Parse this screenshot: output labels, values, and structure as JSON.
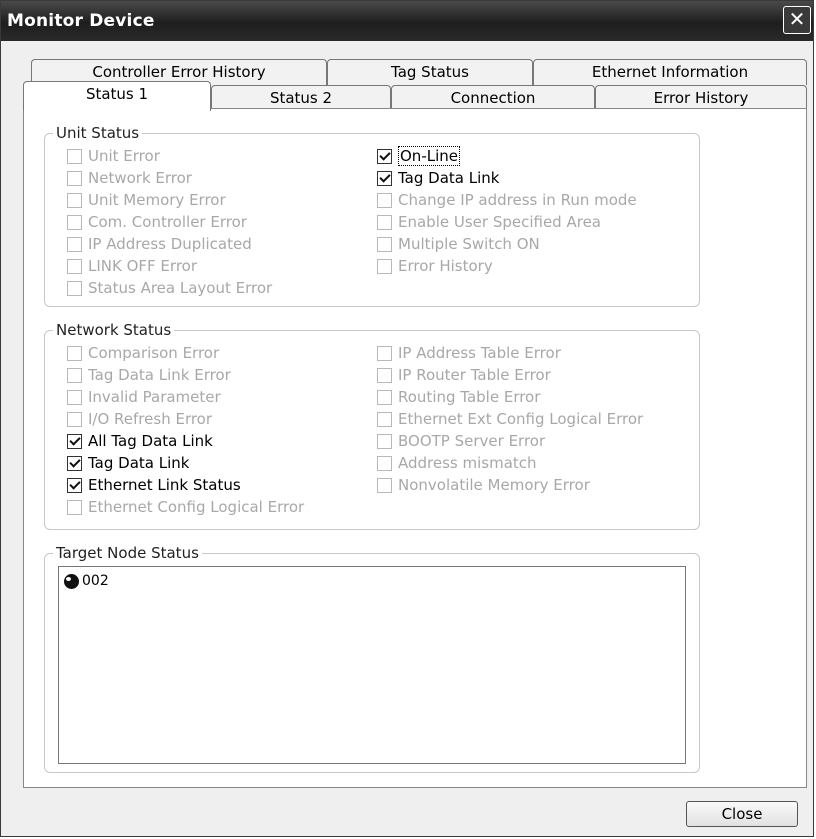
{
  "window": {
    "title": "Monitor Device",
    "close_icon": "close-icon"
  },
  "tabs_back": [
    "Controller Error History",
    "Tag Status",
    "Ethernet Information"
  ],
  "tabs_front": [
    "Status 1",
    "Status 2",
    "Connection",
    "Error History"
  ],
  "active_tab": "Status 1",
  "unit_status": {
    "legend": "Unit Status",
    "left": [
      {
        "label": "Unit Error",
        "checked": false,
        "enabled": false
      },
      {
        "label": "Network Error",
        "checked": false,
        "enabled": false
      },
      {
        "label": "Unit Memory Error",
        "checked": false,
        "enabled": false
      },
      {
        "label": "Com. Controller Error",
        "checked": false,
        "enabled": false
      },
      {
        "label": "IP Address Duplicated",
        "checked": false,
        "enabled": false
      },
      {
        "label": "LINK OFF Error",
        "checked": false,
        "enabled": false
      },
      {
        "label": "Status Area Layout Error",
        "checked": false,
        "enabled": false
      }
    ],
    "right": [
      {
        "label": "On-Line",
        "checked": true,
        "enabled": true
      },
      {
        "label": "Tag Data Link",
        "checked": true,
        "enabled": true
      },
      {
        "label": "Change IP address in Run mode",
        "checked": false,
        "enabled": false
      },
      {
        "label": "Enable User Specified Area",
        "checked": false,
        "enabled": false
      },
      {
        "label": "Multiple Switch ON",
        "checked": false,
        "enabled": false
      },
      {
        "label": "Error History",
        "checked": false,
        "enabled": false
      }
    ]
  },
  "network_status": {
    "legend": "Network Status",
    "left": [
      {
        "label": "Comparison Error",
        "checked": false,
        "enabled": false
      },
      {
        "label": "Tag Data Link Error",
        "checked": false,
        "enabled": false
      },
      {
        "label": "Invalid Parameter",
        "checked": false,
        "enabled": false
      },
      {
        "label": "I/O Refresh Error",
        "checked": false,
        "enabled": false
      },
      {
        "label": "All Tag Data Link",
        "checked": true,
        "enabled": true
      },
      {
        "label": "Tag Data Link",
        "checked": true,
        "enabled": true
      },
      {
        "label": "Ethernet Link Status",
        "checked": true,
        "enabled": true
      },
      {
        "label": "Ethernet Config Logical Error",
        "checked": false,
        "enabled": false
      }
    ],
    "right": [
      {
        "label": "IP Address Table Error",
        "checked": false,
        "enabled": false
      },
      {
        "label": "IP Router Table Error",
        "checked": false,
        "enabled": false
      },
      {
        "label": "Routing Table Error",
        "checked": false,
        "enabled": false
      },
      {
        "label": "Ethernet Ext Config Logical Error",
        "checked": false,
        "enabled": false
      },
      {
        "label": "BOOTP Server Error",
        "checked": false,
        "enabled": false
      },
      {
        "label": "Address mismatch",
        "checked": false,
        "enabled": false
      },
      {
        "label": "Nonvolatile Memory Error",
        "checked": false,
        "enabled": false
      }
    ]
  },
  "target_node_status": {
    "legend": "Target Node Status",
    "nodes": [
      {
        "label": "002",
        "icon": "node-status-icon"
      }
    ]
  },
  "buttons": {
    "close": "Close"
  }
}
